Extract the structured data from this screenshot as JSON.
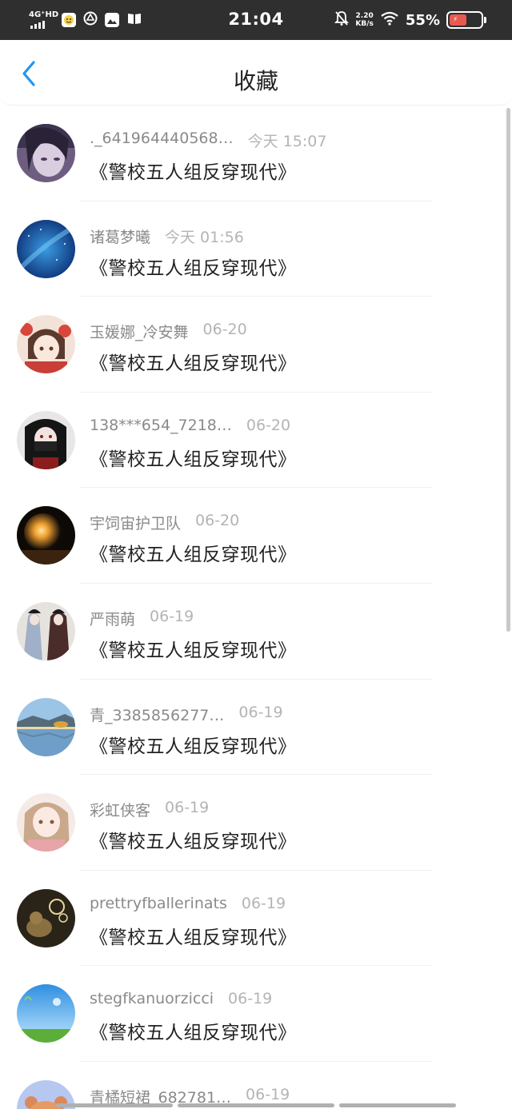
{
  "status_bar": {
    "network": "4G⁺HD",
    "time": "21:04",
    "speed_value": "2.20",
    "speed_unit": "KB/s",
    "battery_pct": "55%",
    "charging_label": "⚡"
  },
  "header": {
    "title": "收藏"
  },
  "favorites": [
    {
      "name": "._641964440568…",
      "time": "今天 15:07",
      "title": "《警校五人组反穿现代》",
      "avatar": "anime-purple"
    },
    {
      "name": "诸葛梦曦",
      "time": "今天 01:56",
      "title": "《警校五人组反穿现代》",
      "avatar": "starry-sky"
    },
    {
      "name": "玉媛娜_冷安舞",
      "time": "06-20",
      "title": "《警校五人组反穿现代》",
      "avatar": "anime-girl-red"
    },
    {
      "name": "138***654_7218…",
      "time": "06-20",
      "title": "《警校五人组反穿现代》",
      "avatar": "masked-girl"
    },
    {
      "name": "宇饲宙护卫队",
      "time": "06-20",
      "title": "《警校五人组反穿现代》",
      "avatar": "light-bulb"
    },
    {
      "name": "严雨萌",
      "time": "06-19",
      "title": "《警校五人组反穿现代》",
      "avatar": "ancient-duo"
    },
    {
      "name": "青_3385856277…",
      "time": "06-19",
      "title": "《警校五人组反穿现代》",
      "avatar": "lake"
    },
    {
      "name": "彩虹侠客",
      "time": "06-19",
      "title": "《警校五人组反穿现代》",
      "avatar": "anime-girl-pink"
    },
    {
      "name": "prettryfballerinats",
      "time": "06-19",
      "title": "《警校五人组反穿现代》",
      "avatar": "cat-bubbles"
    },
    {
      "name": "stegfkanuorzicci",
      "time": "06-19",
      "title": "《警校五人组反穿现代》",
      "avatar": "sky-grass"
    },
    {
      "name": "青橘短裙_682781…",
      "time": "06-19",
      "title": "",
      "avatar": "bear"
    }
  ]
}
